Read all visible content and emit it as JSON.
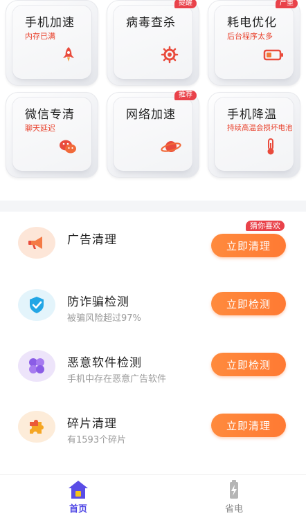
{
  "tools": [
    {
      "title": "手机加速",
      "subtitle": "内存已满",
      "badge": "",
      "icon": "rocket-icon"
    },
    {
      "title": "病毒查杀",
      "subtitle": "",
      "badge": "提醒",
      "icon": "virus-scan-icon"
    },
    {
      "title": "耗电优化",
      "subtitle": "后台程序太多",
      "badge": "严重",
      "icon": "battery-icon"
    },
    {
      "title": "微信专清",
      "subtitle": "聊天延迟",
      "badge": "",
      "icon": "wechat-icon"
    },
    {
      "title": "网络加速",
      "subtitle": "",
      "badge": "推荐",
      "icon": "planet-icon"
    },
    {
      "title": "手机降温",
      "subtitle": "持续高温会损坏电池",
      "badge": "",
      "icon": "thermometer-icon"
    }
  ],
  "features": [
    {
      "title": "广告清理",
      "desc": "",
      "button": "立即清理",
      "badge": "猜你喜欢",
      "icon": "megaphone-icon"
    },
    {
      "title": "防诈骗检测",
      "desc": "被骗风险超过97%",
      "button": "立即检测",
      "badge": "",
      "icon": "shield-check-icon"
    },
    {
      "title": "恶意软件检测",
      "desc": "手机中存在恶意广告软件",
      "button": "立即检测",
      "badge": "",
      "icon": "clover-icon"
    },
    {
      "title": "碎片清理",
      "desc": "有1593个碎片",
      "button": "立即清理",
      "badge": "",
      "icon": "puzzle-icon"
    }
  ],
  "nav": {
    "home_label": "首页",
    "power_label": "省电",
    "active": "首页",
    "active_color": "#4f46e5",
    "inactive_color": "#8a8a8a"
  },
  "colors": {
    "accent_orange": "#ff7a33",
    "alert_red": "#e9424a",
    "subtitle_red": "#e8402b"
  }
}
